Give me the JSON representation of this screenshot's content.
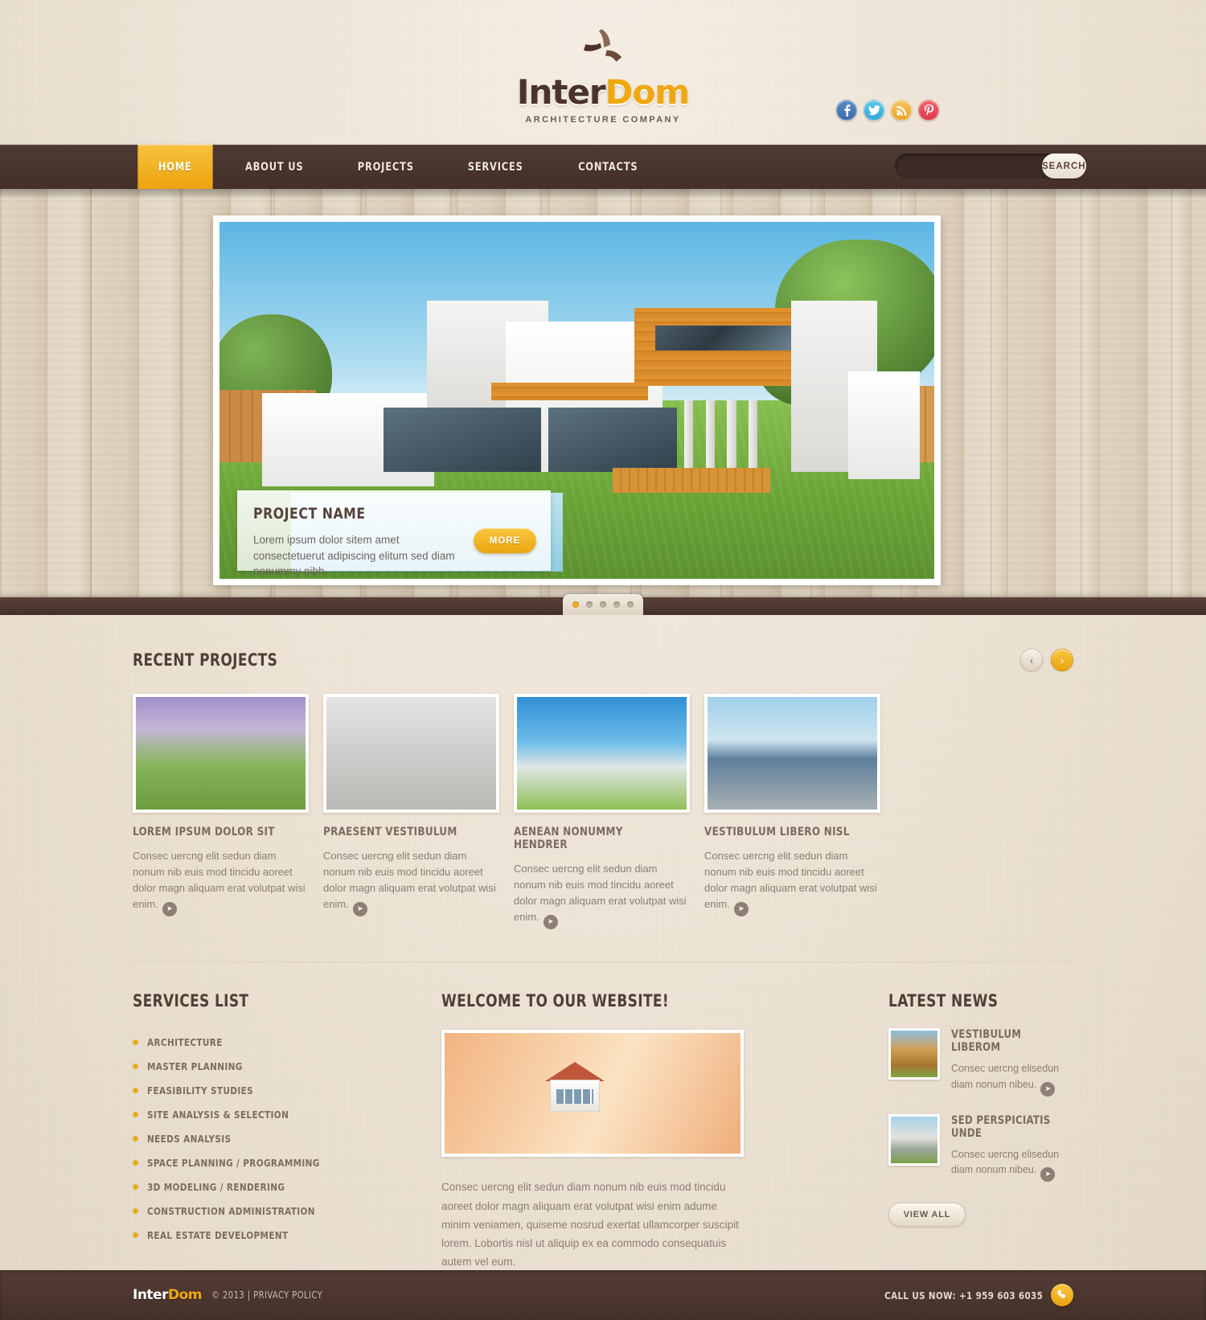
{
  "brand": {
    "name_part1": "Inter",
    "name_part2": "Dom",
    "tagline": "ARCHITECTURE COMPANY",
    "accent_color": "#efa80f",
    "dark_color": "#4a332a"
  },
  "social": [
    {
      "name": "facebook",
      "icon": "facebook-icon",
      "color": "#3b6aa8"
    },
    {
      "name": "twitter",
      "icon": "twitter-icon",
      "color": "#34a8d8"
    },
    {
      "name": "rss",
      "icon": "rss-icon",
      "color": "#eaa528"
    },
    {
      "name": "pinterest",
      "icon": "pinterest-icon",
      "color": "#dd3b4b"
    }
  ],
  "nav": {
    "items": [
      {
        "label": "HOME",
        "active": true
      },
      {
        "label": "ABOUT US",
        "active": false
      },
      {
        "label": "PROJECTS",
        "active": false
      },
      {
        "label": "SERVICES",
        "active": false
      },
      {
        "label": "CONTACTS",
        "active": false
      }
    ]
  },
  "search": {
    "value": "",
    "placeholder": "",
    "button_label": "SEARCH"
  },
  "slider": {
    "caption_title": "PROJECT NAME",
    "caption_text": "Lorem ipsum dolor sitem amet consectetuerut adipiscing elitum sed diam nonummy nibh.",
    "more_label": "MORE",
    "dots": 5,
    "active_dot": 0
  },
  "recent_projects": {
    "title": "RECENT PROJECTS",
    "prev_label": "‹",
    "next_label": "›",
    "items": [
      {
        "title": "LOREM IPSUM DOLOR SIT",
        "text": "Consec uercng elit sedun diam nonum nib euis mod tincidu aoreet dolor magn aliquam erat volutpat wisi enim."
      },
      {
        "title": "PRAESENT VESTIBULUM",
        "text": "Consec uercng elit sedun diam nonum nib euis mod tincidu aoreet dolor magn aliquam erat volutpat wisi enim."
      },
      {
        "title": "AENEAN NONUMMY HENDRER",
        "text": "Consec uercng elit sedun diam nonum nib euis mod tincidu aoreet dolor magn aliquam erat volutpat wisi enim."
      },
      {
        "title": "VESTIBULUM LIBERO NISL",
        "text": "Consec uercng elit sedun diam nonum nib euis mod tincidu aoreet dolor magn aliquam erat volutpat wisi enim."
      }
    ]
  },
  "services": {
    "title": "SERVICES LIST",
    "items": [
      "ARCHITECTURE",
      "MASTER PLANNING",
      "FEASIBILITY STUDIES",
      "SITE ANALYSIS & SELECTION",
      "NEEDS ANALYSIS",
      "SPACE PLANNING / PROGRAMMING",
      "3D MODELING / RENDERING",
      "CONSTRUCTION ADMINISTRATION",
      "REAL ESTATE DEVELOPMENT"
    ]
  },
  "welcome": {
    "title": "WELCOME TO OUR WEBSITE!",
    "text": "Consec uercng elit sedun diam nonum nib euis mod tincidu aoreet dolor magn aliquam erat volutpat wisi enim adume minim veniamen, quiseme nosrud exertat ullamcorper suscipit lorem. Lobortis nisl ut aliquip ex ea commodo consequatuis autem vel eum."
  },
  "news": {
    "title": "LATEST NEWS",
    "items": [
      {
        "title": "VESTIBULUM LIBEROM",
        "text": "Consec uercng elisedun diam nonum nibeu."
      },
      {
        "title": "SED PERSPICIATIS UNDE",
        "text": "Consec uercng elisedun diam nonum nibeu."
      }
    ],
    "view_all_label": "VIEW ALL"
  },
  "footer": {
    "logo_part1": "Inter",
    "logo_part2": "Dom",
    "copyright": "© 2013  |  ",
    "privacy_label": "PRIVACY POLICY",
    "call_label": "CALL US NOW: +1 959 603 6035",
    "phone_icon": "phone-icon"
  }
}
